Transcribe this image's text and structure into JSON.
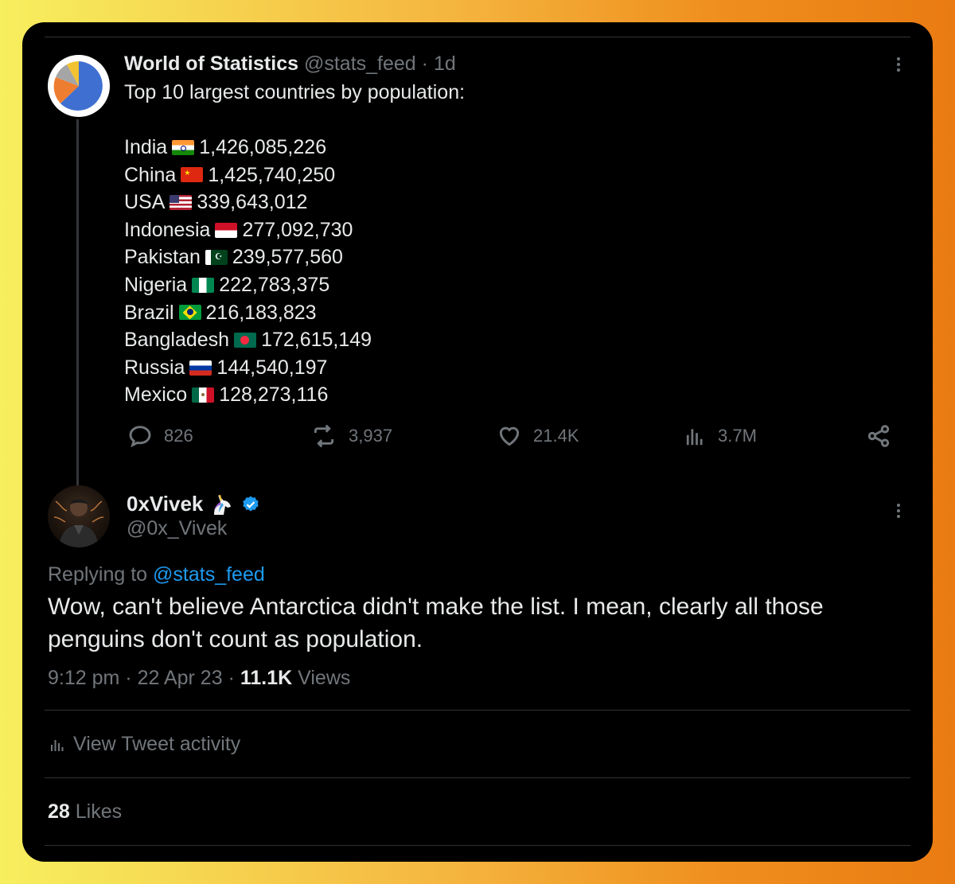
{
  "parent": {
    "author_name": "World of Statistics",
    "handle": "@stats_feed",
    "separator": "·",
    "age": "1d",
    "intro": "Top 10 largest countries by population:",
    "countries": [
      {
        "name": "India",
        "flag": "india-flag",
        "population": "1,426,085,226"
      },
      {
        "name": "China",
        "flag": "china-flag",
        "population": "1,425,740,250"
      },
      {
        "name": "USA",
        "flag": "usa-flag",
        "population": "339,643,012"
      },
      {
        "name": "Indonesia",
        "flag": "indonesia-flag",
        "population": "277,092,730"
      },
      {
        "name": "Pakistan",
        "flag": "pakistan-flag",
        "population": "239,577,560"
      },
      {
        "name": "Nigeria",
        "flag": "nigeria-flag",
        "population": "222,783,375"
      },
      {
        "name": "Brazil",
        "flag": "brazil-flag",
        "population": "216,183,823"
      },
      {
        "name": "Bangladesh",
        "flag": "bangladesh-flag",
        "population": "172,615,149"
      },
      {
        "name": "Russia",
        "flag": "russia-flag",
        "population": "144,540,197"
      },
      {
        "name": "Mexico",
        "flag": "mexico-flag",
        "population": "128,273,116"
      }
    ],
    "stats": {
      "replies": "826",
      "retweets": "3,937",
      "likes": "21.4K",
      "views": "3.7M"
    }
  },
  "reply": {
    "author_name": "0xVivek",
    "author_emoji": "unicorn-icon",
    "verified": true,
    "handle": "@0x_Vivek",
    "replying_prefix": "Replying to",
    "replying_to": "@stats_feed",
    "text": "Wow, can't believe Antarctica didn't make the list. I mean, clearly all those penguins don't count as population.",
    "time": "9:12 pm",
    "date": "22 Apr 23",
    "views_count": "11.1K",
    "views_label": "Views",
    "dot": "·",
    "activity_label": "View Tweet activity",
    "likes_count": "28",
    "likes_label": "Likes"
  },
  "colors": {
    "accent": "#1d9bf0",
    "muted": "#71767b",
    "text": "#e7e9ea",
    "background": "#000000"
  }
}
